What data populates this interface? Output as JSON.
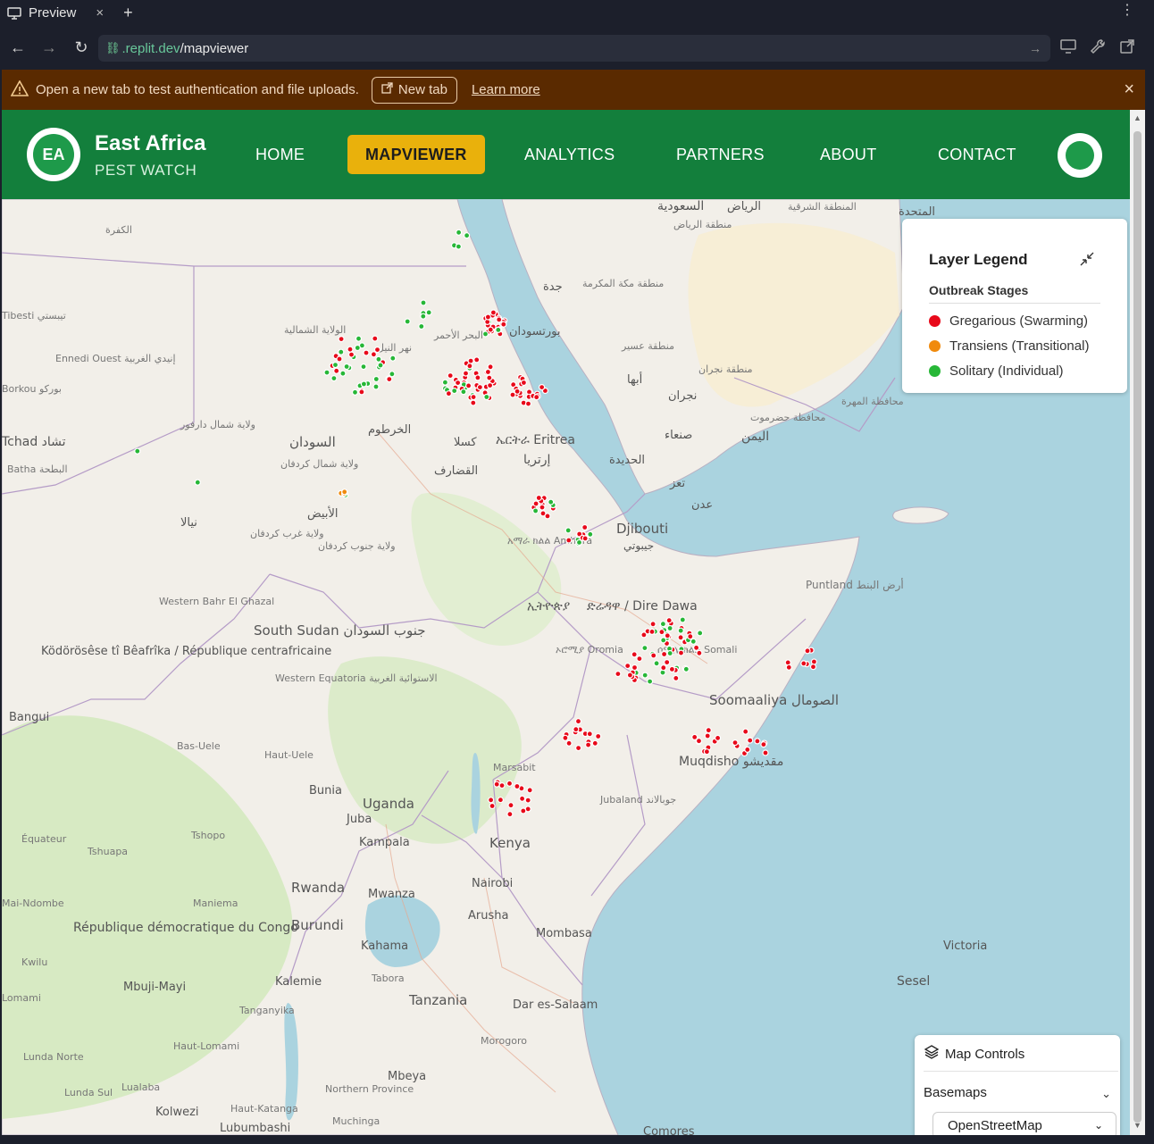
{
  "browser": {
    "tab_title": "Preview",
    "tab_close": "×",
    "tab_new": "+",
    "menu": "⋮",
    "url_domain": ".replit.dev",
    "url_path": "/mapviewer"
  },
  "banner": {
    "message": "Open a new tab to test authentication and file uploads.",
    "new_tab_label": "New tab",
    "learn_more": "Learn more",
    "close": "×",
    "background": "#5a2a00"
  },
  "header": {
    "logo_text": "EA",
    "brand_title": "East Africa",
    "brand_subtitle": "PEST WATCH",
    "nav": [
      "HOME",
      "MAPVIEWER",
      "ANALYTICS",
      "PARTNERS",
      "ABOUT",
      "CONTACT"
    ],
    "active_nav": "MAPVIEWER",
    "primary_color": "#137f3c",
    "active_color": "#e9b10c"
  },
  "legend": {
    "title": "Layer Legend",
    "subtitle": "Outbreak Stages",
    "items": [
      {
        "label": "Gregarious (Swarming)",
        "color": "#e8091a"
      },
      {
        "label": "Transiens (Transitional)",
        "color": "#f08a0c"
      },
      {
        "label": "Solitary (Individual)",
        "color": "#27b737"
      }
    ]
  },
  "controls": {
    "title": "Map Controls",
    "basemaps_label": "Basemaps",
    "basemap_selected": "OpenStreetMap"
  },
  "map_labels": {
    "sudan": "السودان",
    "khartoum": "الخرطوم",
    "portsudan": "بورتسودان",
    "red_sea": "البحر الأحمر",
    "kassala": "كسلا",
    "gedaref": "القضارف",
    "el_obeid": "الأبيض",
    "nyala": "نيالا",
    "eritrea": "ኤርትራ Eritrea",
    "eritrea_ar": "إرتريا",
    "djibouti": "Djibouti",
    "djibouti_ar": "جيبوتي",
    "amhara": "አማራ ክልል Amhara",
    "ethiopia": "ኢትዮጵያ",
    "dire_dawa": "ድሬዳዋ / Dire Dawa",
    "oromia": "ኦሮሚያ Oromia",
    "somali": "ሶማሌ ክልል Somali",
    "puntland": "Puntland أرض البنط",
    "somalia": "Soomaaliya الصومال",
    "mogadishu": "Muqdisho مقديشو",
    "south_sudan": "South Sudan جنوب السودان",
    "juba": "Juba",
    "uganda": "Uganda",
    "kampala": "Kampala",
    "kenya": "Kenya",
    "nairobi": "Nairobi",
    "mombasa": "Mombasa",
    "marsabit": "Marsabit",
    "jubaland": "Jubaland جوبالاند",
    "rwanda": "Rwanda",
    "burundi": "Burundi",
    "mwanza": "Mwanza",
    "arusha": "Arusha",
    "kahama": "Kahama",
    "tabora": "Tabora",
    "tanzania": "Tanzania",
    "dar": "Dar es-Salaam",
    "morogoro": "Morogoro",
    "mbeya": "Mbeya",
    "kalemie": "Kalemie",
    "tanganyika": "Tanganyika",
    "drc": "République démocratique du Congo",
    "mbujimayi": "Mbuji-Mayi",
    "kolwezi": "Kolwezi",
    "lubumbashi": "Lubumbashi",
    "car": "Ködörösêse tî Bêafrîka / République centrafricaine",
    "bangui": "Bangui",
    "bunia": "Bunia",
    "chad": "Tchad تشاد",
    "ennedi": "Ennedi Ouest إنيدي الغربية",
    "yemen": "اليمن",
    "sanaa": "صنعاء",
    "aden": "عدن",
    "taiz": "تعز",
    "hodeidah": "الحديدة",
    "jeddah": "جدة",
    "riyadh": "الرياض",
    "saudi": "السعودية",
    "makkah": "منطقة مكة المكرمة",
    "asir": "منطقة عسير",
    "najran": "نجران",
    "najran_region": "منطقة نجران",
    "abha": "أبها",
    "hadramawt": "محافظة حضرموت",
    "mahra": "محافظة المهرة",
    "victoria": "Victoria",
    "sesel": "Sesel",
    "comores": "Comores",
    "western_bahr": "Western Bahr El Ghazal",
    "western_equatoria": "Western Equatoria الاستوائية الغربية",
    "bas_uele": "Bas-Uele",
    "haut_uele": "Haut-Uele",
    "tshopo": "Tshopo",
    "tshuapa": "Tshuapa",
    "equateur": "Équateur",
    "maniema": "Maniema",
    "kwilu": "Kwilu",
    "haut_lomami": "Haut-Lomami",
    "lualaba": "Lualaba",
    "lunda_norte": "Lunda Norte",
    "lunda_sul": "Lunda Sul",
    "haut_katanga": "Haut-Katanga",
    "northern_province": "Northern Province",
    "muchinga": "Muchinga",
    "batha": "Batha البطحة",
    "north_darfur": "ولاية شمال دارفور",
    "north_kordofan": "ولاية شمال كردفان",
    "west_kordofan": "ولاية غرب كردفان",
    "south_kordofan": "ولاية جنوب كردفان",
    "northern_state": "الولاية الشمالية",
    "nile": "نهر النيل",
    "kufra": "الكفرة",
    "tibesti": "Tibesti تيبستي",
    "borkou": "Borkou بوركو",
    "mai_ndombe": "Mai-Ndombe",
    "lomami": "Lomami",
    "eastern_province": "المنطقة الشرقية",
    "riyadh_region": "منطقة الرياض",
    "uae": "المتحدة"
  }
}
